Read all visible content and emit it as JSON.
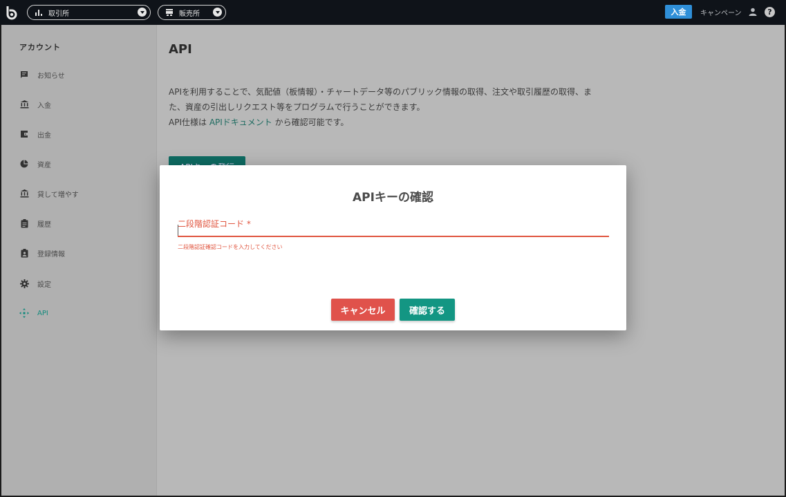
{
  "header": {
    "exchange_label": "取引所",
    "shop_label": "販売所",
    "deposit_label": "入金",
    "campaign_label": "キャンペーン"
  },
  "sidebar": {
    "heading": "アカウント",
    "items": [
      {
        "label": "お知らせ",
        "icon": "message-icon"
      },
      {
        "label": "入金",
        "icon": "bank-icon"
      },
      {
        "label": "出金",
        "icon": "wallet-icon"
      },
      {
        "label": "資産",
        "icon": "pie-chart-icon"
      },
      {
        "label": "貸して増やす",
        "icon": "bank-icon"
      },
      {
        "label": "履歴",
        "icon": "clipboard-icon"
      },
      {
        "label": "登録情報",
        "icon": "id-card-icon"
      },
      {
        "label": "設定",
        "icon": "gear-icon"
      },
      {
        "label": "API",
        "icon": "api-icon"
      }
    ]
  },
  "main": {
    "title": "API",
    "desc_line1": "APIを利用することで、気配値（板情報）・チャートデータ等のパブリック情報の取得、注文や取引履歴の取得、ま",
    "desc_line2": "た、資産の引出しリクエスト等をプログラムで行うことができます。",
    "desc_line3_prefix": "API仕様は ",
    "desc_link": "APIドキュメント",
    "desc_line3_suffix": " から確認可能です。",
    "issue_button": "APIキーの発行"
  },
  "modal": {
    "title": "APIキーの確認",
    "field_label": "二段階認証コード *",
    "field_value": "",
    "error": "二段階認証確認コードを入力してください",
    "cancel": "キャンセル",
    "confirm": "確認する"
  },
  "colors": {
    "topbar": "#0f1319",
    "accent": "#139683",
    "danger": "#e0524b",
    "deposit": "#2f8fd8"
  }
}
